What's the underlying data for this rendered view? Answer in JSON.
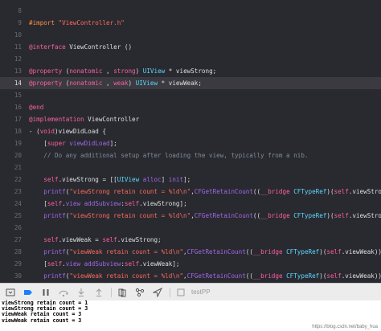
{
  "editor": {
    "current_line": "14",
    "lines": [
      {
        "num": "8",
        "segments": []
      },
      {
        "num": "9",
        "segments": [
          {
            "t": "#import ",
            "c": "pre"
          },
          {
            "t": "\"ViewController.h\"",
            "c": "str"
          }
        ]
      },
      {
        "num": "10",
        "segments": []
      },
      {
        "num": "11",
        "segments": [
          {
            "t": "@interface",
            "c": "kw"
          },
          {
            "t": " ViewController ()",
            "c": "plain"
          }
        ]
      },
      {
        "num": "12",
        "segments": []
      },
      {
        "num": "13",
        "segments": [
          {
            "t": "@property",
            "c": "kw"
          },
          {
            "t": " (",
            "c": "plain"
          },
          {
            "t": "nonatomic",
            "c": "kw"
          },
          {
            "t": " , ",
            "c": "plain"
          },
          {
            "t": "strong",
            "c": "kw"
          },
          {
            "t": ") ",
            "c": "plain"
          },
          {
            "t": "UIView",
            "c": "type"
          },
          {
            "t": " * viewStrong;",
            "c": "plain"
          }
        ]
      },
      {
        "num": "14",
        "segments": [
          {
            "t": "@property",
            "c": "kw"
          },
          {
            "t": " (",
            "c": "plain"
          },
          {
            "t": "nonatomic",
            "c": "kw"
          },
          {
            "t": " , ",
            "c": "plain"
          },
          {
            "t": "weak",
            "c": "kw"
          },
          {
            "t": ") ",
            "c": "plain"
          },
          {
            "t": "UIView",
            "c": "type"
          },
          {
            "t": " * viewWeak;",
            "c": "plain"
          }
        ]
      },
      {
        "num": "15",
        "segments": []
      },
      {
        "num": "16",
        "segments": [
          {
            "t": "@end",
            "c": "kw"
          }
        ]
      },
      {
        "num": "17",
        "segments": [
          {
            "t": "@implementation",
            "c": "kw"
          },
          {
            "t": " ViewController",
            "c": "plain"
          }
        ]
      },
      {
        "num": "18",
        "segments": [
          {
            "t": "- (",
            "c": "plain"
          },
          {
            "t": "void",
            "c": "kw"
          },
          {
            "t": ")viewDidLoad {",
            "c": "plain"
          }
        ]
      },
      {
        "num": "19",
        "segments": [
          {
            "t": "    [",
            "c": "plain"
          },
          {
            "t": "super",
            "c": "kw"
          },
          {
            "t": " ",
            "c": "plain"
          },
          {
            "t": "viewDidLoad",
            "c": "fn"
          },
          {
            "t": "];",
            "c": "plain"
          }
        ]
      },
      {
        "num": "20",
        "segments": [
          {
            "t": "    // Do any additional setup after loading the view, typically from a nib.",
            "c": "cmt"
          }
        ]
      },
      {
        "num": "21",
        "segments": []
      },
      {
        "num": "22",
        "segments": [
          {
            "t": "    ",
            "c": "plain"
          },
          {
            "t": "self",
            "c": "kw"
          },
          {
            "t": ".viewStrong = [[",
            "c": "plain"
          },
          {
            "t": "UIView",
            "c": "type"
          },
          {
            "t": " ",
            "c": "plain"
          },
          {
            "t": "alloc",
            "c": "fn"
          },
          {
            "t": "] ",
            "c": "plain"
          },
          {
            "t": "init",
            "c": "fn"
          },
          {
            "t": "];",
            "c": "plain"
          }
        ]
      },
      {
        "num": "23",
        "segments": [
          {
            "t": "    ",
            "c": "plain"
          },
          {
            "t": "printf",
            "c": "fn"
          },
          {
            "t": "(",
            "c": "plain"
          },
          {
            "t": "\"viewStrong retain count = %ld\\n\"",
            "c": "str"
          },
          {
            "t": ",",
            "c": "plain"
          },
          {
            "t": "CFGetRetainCount",
            "c": "fn"
          },
          {
            "t": "((",
            "c": "plain"
          },
          {
            "t": "__bridge",
            "c": "kw"
          },
          {
            "t": " ",
            "c": "plain"
          },
          {
            "t": "CFTypeRef",
            "c": "type"
          },
          {
            "t": ")(",
            "c": "plain"
          },
          {
            "t": "self",
            "c": "kw"
          },
          {
            "t": ".viewStrong)));",
            "c": "plain"
          }
        ]
      },
      {
        "num": "24",
        "segments": [
          {
            "t": "    [",
            "c": "plain"
          },
          {
            "t": "self",
            "c": "kw"
          },
          {
            "t": ".",
            "c": "plain"
          },
          {
            "t": "view",
            "c": "fn"
          },
          {
            "t": " ",
            "c": "plain"
          },
          {
            "t": "addSubview",
            "c": "fn"
          },
          {
            "t": ":",
            "c": "plain"
          },
          {
            "t": "self",
            "c": "kw"
          },
          {
            "t": ".viewStrong];",
            "c": "plain"
          }
        ]
      },
      {
        "num": "25",
        "segments": [
          {
            "t": "    ",
            "c": "plain"
          },
          {
            "t": "printf",
            "c": "fn"
          },
          {
            "t": "(",
            "c": "plain"
          },
          {
            "t": "\"viewStrong retain count = %ld\\n\"",
            "c": "str"
          },
          {
            "t": ",",
            "c": "plain"
          },
          {
            "t": "CFGetRetainCount",
            "c": "fn"
          },
          {
            "t": "((",
            "c": "plain"
          },
          {
            "t": "__bridge",
            "c": "kw"
          },
          {
            "t": " ",
            "c": "plain"
          },
          {
            "t": "CFTypeRef",
            "c": "type"
          },
          {
            "t": ")(",
            "c": "plain"
          },
          {
            "t": "self",
            "c": "kw"
          },
          {
            "t": ".viewStrong)));",
            "c": "plain"
          }
        ]
      },
      {
        "num": "26",
        "segments": []
      },
      {
        "num": "27",
        "segments": [
          {
            "t": "    ",
            "c": "plain"
          },
          {
            "t": "self",
            "c": "kw"
          },
          {
            "t": ".viewWeak = ",
            "c": "plain"
          },
          {
            "t": "self",
            "c": "kw"
          },
          {
            "t": ".viewStrong;",
            "c": "plain"
          }
        ]
      },
      {
        "num": "28",
        "segments": [
          {
            "t": "    ",
            "c": "plain"
          },
          {
            "t": "printf",
            "c": "fn"
          },
          {
            "t": "(",
            "c": "plain"
          },
          {
            "t": "\"viewWeak retain count = %ld\\n\"",
            "c": "str"
          },
          {
            "t": ",",
            "c": "plain"
          },
          {
            "t": "CFGetRetainCount",
            "c": "fn"
          },
          {
            "t": "((",
            "c": "plain"
          },
          {
            "t": "__bridge",
            "c": "kw"
          },
          {
            "t": " ",
            "c": "plain"
          },
          {
            "t": "CFTypeRef",
            "c": "type"
          },
          {
            "t": ")(",
            "c": "plain"
          },
          {
            "t": "self",
            "c": "kw"
          },
          {
            "t": ".viewWeak)));",
            "c": "plain"
          }
        ]
      },
      {
        "num": "29",
        "segments": [
          {
            "t": "    [",
            "c": "plain"
          },
          {
            "t": "self",
            "c": "kw"
          },
          {
            "t": ".",
            "c": "plain"
          },
          {
            "t": "view",
            "c": "fn"
          },
          {
            "t": " ",
            "c": "plain"
          },
          {
            "t": "addSubview",
            "c": "fn"
          },
          {
            "t": ":",
            "c": "plain"
          },
          {
            "t": "self",
            "c": "kw"
          },
          {
            "t": ".viewWeak];",
            "c": "plain"
          }
        ]
      },
      {
        "num": "30",
        "segments": [
          {
            "t": "    ",
            "c": "plain"
          },
          {
            "t": "printf",
            "c": "fn"
          },
          {
            "t": "(",
            "c": "plain"
          },
          {
            "t": "\"viewWeak retain count = %ld\\n\"",
            "c": "str"
          },
          {
            "t": ",",
            "c": "plain"
          },
          {
            "t": "CFGetRetainCount",
            "c": "fn"
          },
          {
            "t": "((",
            "c": "plain"
          },
          {
            "t": "__bridge",
            "c": "kw"
          },
          {
            "t": " ",
            "c": "plain"
          },
          {
            "t": "CFTypeRef",
            "c": "type"
          },
          {
            "t": ")(",
            "c": "plain"
          },
          {
            "t": "self",
            "c": "kw"
          },
          {
            "t": ".viewWeak)));",
            "c": "plain"
          }
        ]
      },
      {
        "num": "31",
        "segments": []
      },
      {
        "num": "32",
        "segments": [
          {
            "t": "}",
            "c": "plain"
          }
        ]
      },
      {
        "num": "33",
        "segments": [
          {
            "t": "@end",
            "c": "kw"
          }
        ]
      },
      {
        "num": "34",
        "segments": []
      },
      {
        "num": "35",
        "segments": []
      }
    ]
  },
  "debug_bar": {
    "process_label": "testPP",
    "icons": [
      "hide-debug-area-icon",
      "breakpoints-toggle-icon",
      "pause-icon",
      "step-over-icon",
      "step-into-icon",
      "step-out-icon",
      "view-hierarchy-icon",
      "memory-graph-icon",
      "simulate-location-icon"
    ]
  },
  "console": {
    "lines": [
      "viewStrong retain count = 1",
      "viewStrong retain count = 3",
      "viewWeak retain count = 3",
      "viewWeak retain count = 3"
    ],
    "watermark": "https://blog.csdn.net/baby_hua"
  },
  "colors": {
    "editor_background": "#292a30",
    "keyword": "#fc5fa3",
    "string": "#fc6a5d",
    "preprocessor": "#fd8f3f",
    "type": "#5dd8ff",
    "function": "#a167e6",
    "comment": "#7f8c98",
    "plain": "#dfdfe0",
    "line_highlight": "#3a3a40",
    "debug_accent": "#1a82fb"
  }
}
